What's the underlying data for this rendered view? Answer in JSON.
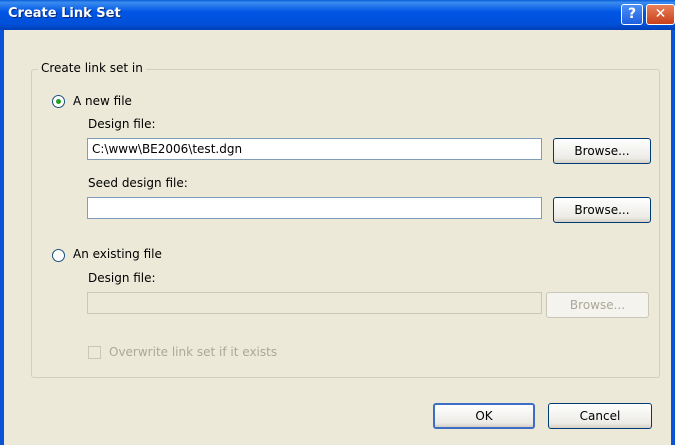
{
  "dialog": {
    "title": "Create Link Set",
    "help_glyph": "?",
    "close_glyph": "✕"
  },
  "group": {
    "label": "Create link set in"
  },
  "new_file": {
    "radio_label": "A new file",
    "selected": true,
    "design_label": "Design file:",
    "design_value": "C:\\www\\BE2006\\test.dgn",
    "browse_label": "Browse...",
    "seed_label": "Seed design file:",
    "seed_value": "",
    "seed_browse_label": "Browse..."
  },
  "existing_file": {
    "radio_label": "An existing file",
    "selected": false,
    "design_label": "Design file:",
    "design_value": "",
    "browse_label": "Browse...",
    "overwrite_label": "Overwrite link set if it exists",
    "overwrite_checked": false
  },
  "footer": {
    "ok_label": "OK",
    "cancel_label": "Cancel"
  }
}
